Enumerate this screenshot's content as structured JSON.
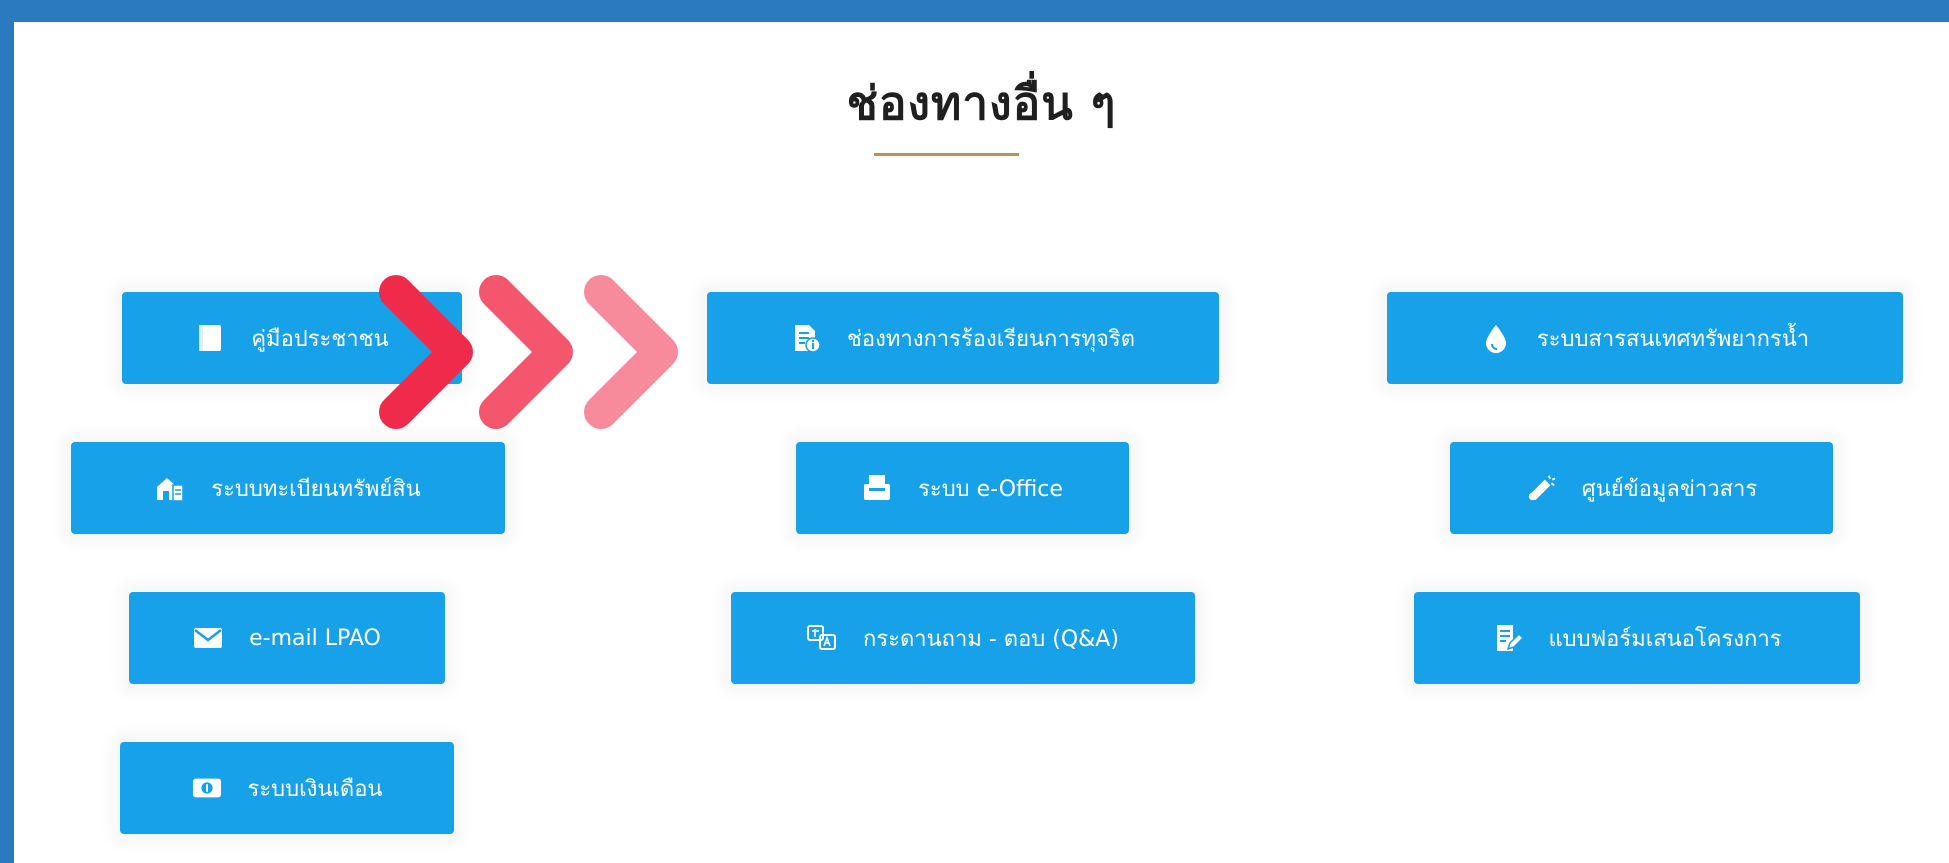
{
  "section": {
    "title": "ช่องทางอื่น ๆ",
    "underline_color": "#b89556"
  },
  "colors": {
    "button_bg": "#16a1e8",
    "frame_border": "#2b79bf",
    "arrow_1": "#f02a4b",
    "arrow_2": "#f4566d",
    "arrow_3": "#f88b9b"
  },
  "buttons": {
    "citizen_manual": {
      "label": "คู่มือประชาชน",
      "icon": "book-icon"
    },
    "corruption_complaint": {
      "label": "ช่องทางการร้องเรียนการทุจริต",
      "icon": "document-info-icon"
    },
    "water_info": {
      "label": "ระบบสารสนเทศทรัพยากรน้ำ",
      "icon": "water-drop-icon"
    },
    "asset_registry": {
      "label": "ระบบทะเบียนทรัพย์สิน",
      "icon": "house-document-icon"
    },
    "e_office": {
      "label": "ระบบ e-Office",
      "icon": "office-print-icon"
    },
    "info_center": {
      "label": "ศูนย์ข้อมูลข่าวสาร",
      "icon": "megaphone-icon"
    },
    "email": {
      "label": "e-mail LPAO",
      "icon": "envelope-icon"
    },
    "qa_board": {
      "label": "กระดานถาม - ตอบ (Q&A)",
      "icon": "translate-chat-icon"
    },
    "project_form": {
      "label": "แบบฟอร์มเสนอโครงการ",
      "icon": "form-edit-icon"
    },
    "salary": {
      "label": "ระบบเงินเดือน",
      "icon": "money-icon"
    }
  },
  "decoration": {
    "arrows_icon": "triple-chevron-right-icon"
  }
}
